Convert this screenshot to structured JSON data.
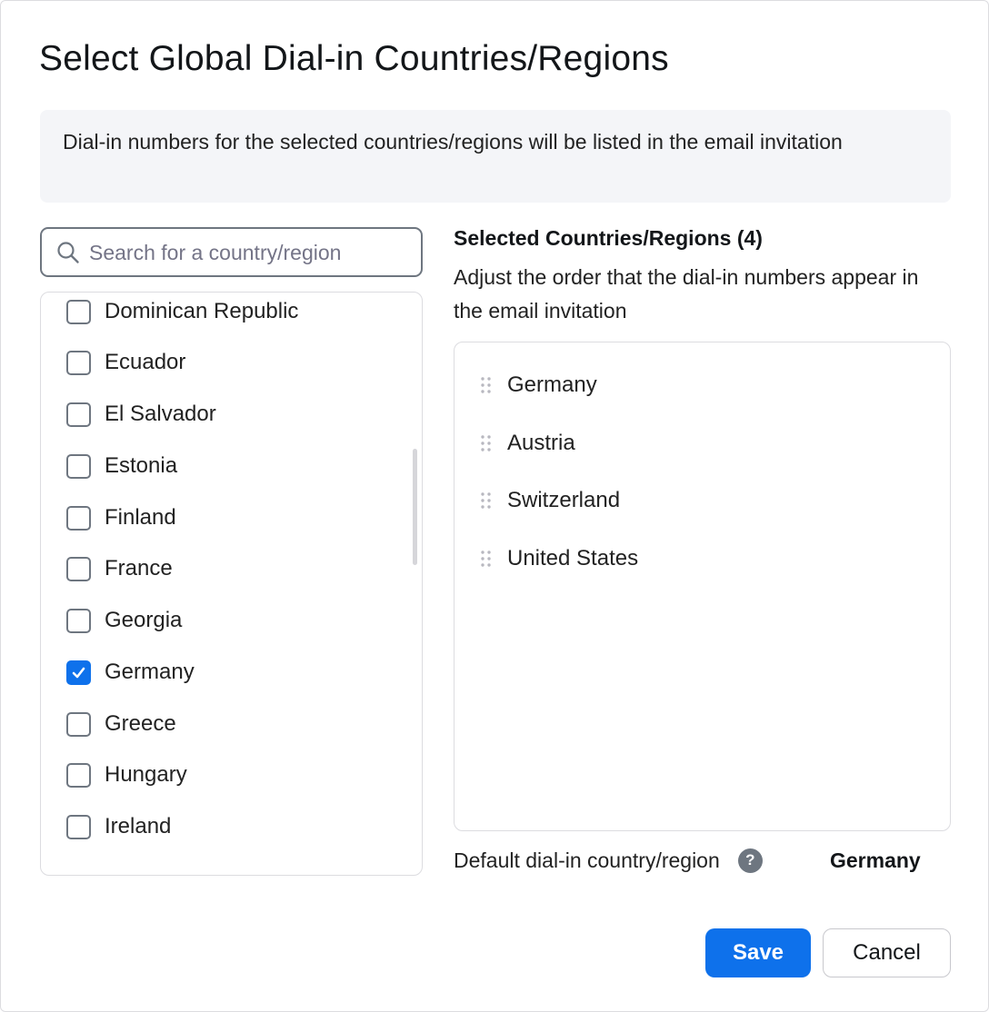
{
  "dialog": {
    "title": "Select Global Dial-in Countries/Regions",
    "info": "Dial-in numbers for the selected countries/regions will be listed in the email invitation"
  },
  "search": {
    "placeholder": "Search for a country/region",
    "icon": "search-icon"
  },
  "countries": [
    {
      "name": "Dominican Republic",
      "checked": false
    },
    {
      "name": "Ecuador",
      "checked": false
    },
    {
      "name": "El Salvador",
      "checked": false
    },
    {
      "name": "Estonia",
      "checked": false
    },
    {
      "name": "Finland",
      "checked": false
    },
    {
      "name": "France",
      "checked": false
    },
    {
      "name": "Georgia",
      "checked": false
    },
    {
      "name": "Germany",
      "checked": true
    },
    {
      "name": "Greece",
      "checked": false
    },
    {
      "name": "Hungary",
      "checked": false
    },
    {
      "name": "Ireland",
      "checked": false
    }
  ],
  "selected": {
    "heading": "Selected Countries/Regions (4)",
    "description": "Adjust the order that the dial-in numbers appear in the email invitation",
    "items": [
      "Germany",
      "Austria",
      "Switzerland",
      "United States"
    ]
  },
  "default_country": {
    "label": "Default dial-in country/region",
    "help_icon": "?",
    "value": "Germany"
  },
  "buttons": {
    "save": "Save",
    "cancel": "Cancel"
  },
  "colors": {
    "accent": "#0e71eb",
    "info_bg": "#f4f5f8",
    "border": "#dcdce0"
  }
}
